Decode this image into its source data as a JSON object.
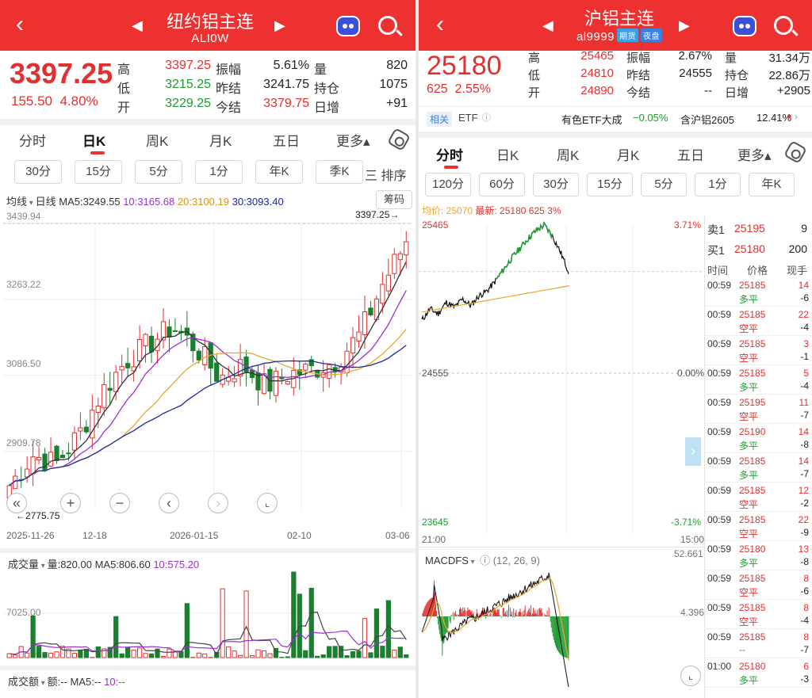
{
  "left": {
    "header": {
      "title": "纽约铝主连",
      "code": "ALI0W"
    },
    "quote": {
      "price": "3397.25",
      "change": "155.50",
      "change_pct": "4.80%",
      "stats": [
        {
          "label": "高",
          "value": "3397.25",
          "color": "red"
        },
        {
          "label": "振幅",
          "value": "5.61%",
          "color": "dk"
        },
        {
          "label": "量",
          "value": "820",
          "color": "dk"
        },
        {
          "label": "低",
          "value": "3215.25",
          "color": "green"
        },
        {
          "label": "昨结",
          "value": "3241.75",
          "color": "dk"
        },
        {
          "label": "持仓",
          "value": "1075",
          "color": "dk"
        },
        {
          "label": "开",
          "value": "3229.25",
          "color": "green"
        },
        {
          "label": "今结",
          "value": "3379.75",
          "color": "red"
        },
        {
          "label": "日增",
          "value": "+91",
          "color": "dk"
        }
      ]
    },
    "tabs": [
      "分时",
      "日K",
      "周K",
      "月K",
      "五日",
      "更多▴"
    ],
    "active_tab": "日K",
    "periods": [
      "30分",
      "15分",
      "5分",
      "1分",
      "年K",
      "季K"
    ],
    "sort_label": "三 排序",
    "ma_bar": {
      "type": "均线",
      "line": "日线",
      "ma5": "MA5:3249.55",
      "ma10": "10:3165.68",
      "ma20": "20:3100.19",
      "ma30": "30:3093.40",
      "chips": "筹码"
    },
    "y_labels": [
      "3439.94",
      "3263.22",
      "3086.50",
      "2909.78",
      "2775.75"
    ],
    "y_values": [
      3439.94,
      3263.22,
      3086.5,
      2909.78,
      2775.75
    ],
    "last_price_label": "3397.25",
    "x_labels": [
      "2025-11-26",
      "12-18",
      "2026-01-15",
      "02-10",
      "03-06"
    ],
    "volume": {
      "title": "成交量",
      "stats": "量:820.00",
      "ma5": "MA5:806.60",
      "ma10": "10:575.20",
      "y_label": "7025.00"
    },
    "amount": {
      "title": "成交额",
      "stats": "额:--",
      "ma5": "MA5:--",
      "ma10": "10:--"
    }
  },
  "right": {
    "header": {
      "title": "沪铝主连",
      "code": "al9999",
      "tag1": "期货",
      "tag2": "夜盘"
    },
    "quote": {
      "price": "25180",
      "change": "625",
      "change_pct": "2.55%",
      "stats": [
        {
          "label": "高",
          "value": "25465",
          "color": "red"
        },
        {
          "label": "振幅",
          "value": "2.67%",
          "color": "dk"
        },
        {
          "label": "量",
          "value": "31.34万",
          "color": "dk"
        },
        {
          "label": "低",
          "value": "24810",
          "color": "red"
        },
        {
          "label": "昨结",
          "value": "24555",
          "color": "dk"
        },
        {
          "label": "持仓",
          "value": "22.86万",
          "color": "dk"
        },
        {
          "label": "开",
          "value": "24890",
          "color": "red"
        },
        {
          "label": "今结",
          "value": "--",
          "color": "dk"
        },
        {
          "label": "日增",
          "value": "+2905",
          "color": "dk"
        }
      ]
    },
    "related": {
      "tag": "相关",
      "etf": "ETF",
      "name": "有色ETF大成",
      "pct": "−0.05%",
      "hold": "含沪铝2605",
      "hold_pct": "12.41%"
    },
    "tabs": [
      "分时",
      "日K",
      "周K",
      "月K",
      "五日",
      "更多▴"
    ],
    "active_tab": "分时",
    "periods": [
      "120分",
      "60分",
      "30分",
      "15分",
      "5分",
      "1分",
      "年K"
    ],
    "legend": {
      "avg": "均价: 25070",
      "latest": "最新: 25180",
      "chg": "625",
      "pct": "3%"
    },
    "y_left": [
      "25465",
      "24555",
      "23645"
    ],
    "y_right": [
      "3.71%",
      "0.00%",
      "-3.71%"
    ],
    "x_labels": [
      "21:00",
      "15:00"
    ],
    "macd": {
      "title": "MACDFS",
      "params": "(12, 26, 9)",
      "top": "52.661",
      "mid": "4.396"
    },
    "book": {
      "sell_label": "卖1",
      "sell_price": "25195",
      "sell_vol": "9",
      "buy_label": "买1",
      "buy_price": "25180",
      "buy_vol": "200"
    },
    "trades_header": [
      "时间",
      "价格",
      "现手"
    ],
    "trades": [
      {
        "time": "00:59",
        "price": "25185",
        "hand": "14",
        "type": "多平",
        "diff": "-6"
      },
      {
        "time": "00:59",
        "price": "25185",
        "hand": "22",
        "type": "空平",
        "diff": "-4"
      },
      {
        "time": "00:59",
        "price": "25185",
        "hand": "3",
        "type": "空平",
        "diff": "-1"
      },
      {
        "time": "00:59",
        "price": "25185",
        "hand": "5",
        "type": "多平",
        "diff": "-4"
      },
      {
        "time": "00:59",
        "price": "25195",
        "hand": "11",
        "type": "空平",
        "diff": "-7"
      },
      {
        "time": "00:59",
        "price": "25190",
        "hand": "14",
        "type": "多平",
        "diff": "-8"
      },
      {
        "time": "00:59",
        "price": "25185",
        "hand": "14",
        "type": "多平",
        "diff": "-7"
      },
      {
        "time": "00:59",
        "price": "25185",
        "hand": "12",
        "type": "空平",
        "diff": "-2"
      },
      {
        "time": "00:59",
        "price": "25185",
        "hand": "22",
        "type": "空平",
        "diff": "-9"
      },
      {
        "time": "00:59",
        "price": "25180",
        "hand": "13",
        "type": "多平",
        "diff": "-8"
      },
      {
        "time": "00:59",
        "price": "25185",
        "hand": "8",
        "type": "空平",
        "diff": "-6"
      },
      {
        "time": "00:59",
        "price": "25185",
        "hand": "8",
        "type": "空平",
        "diff": "-4"
      },
      {
        "time": "00:59",
        "price": "25185",
        "hand": "8",
        "type": "--",
        "diff": "-7"
      },
      {
        "time": "01:00",
        "price": "25180",
        "hand": "6",
        "type": "多平",
        "diff": "-3"
      }
    ]
  },
  "colors": {
    "brand": "#ec3130",
    "up": "#e23030",
    "down": "#1f9a33",
    "ma5": "#333333",
    "ma10": "#9b2fd6",
    "ma20": "#e8a62c",
    "ma30": "#1d2a9e",
    "avg": "#e8a62c"
  }
}
